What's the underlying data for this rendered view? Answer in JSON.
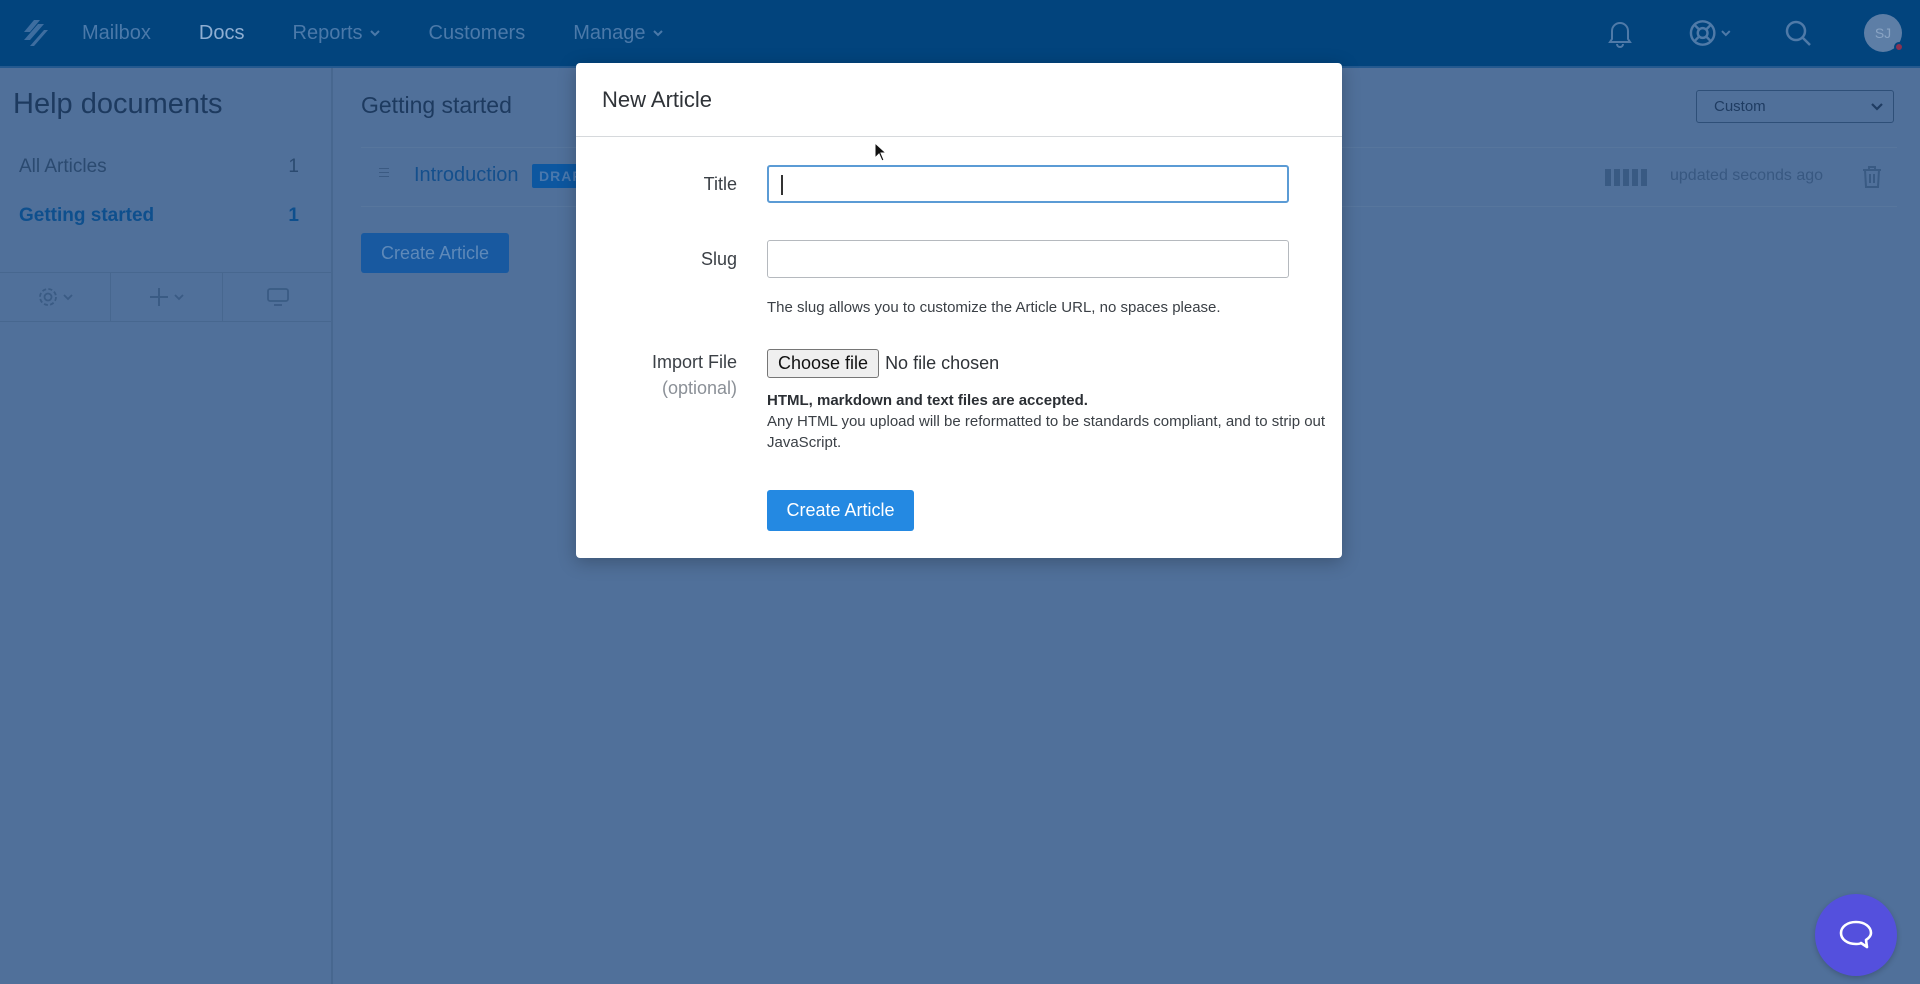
{
  "topnav": {
    "items": [
      {
        "label": "Mailbox",
        "dropdown": false,
        "active": false
      },
      {
        "label": "Docs",
        "dropdown": false,
        "active": true
      },
      {
        "label": "Reports",
        "dropdown": true,
        "active": false
      },
      {
        "label": "Customers",
        "dropdown": false,
        "active": false
      },
      {
        "label": "Manage",
        "dropdown": true,
        "active": false
      }
    ],
    "icons": [
      "bell-icon",
      "lifebuoy-icon",
      "search-icon"
    ],
    "avatar_initials": "SJ"
  },
  "sidebar": {
    "title": "Help documents",
    "items": [
      {
        "label": "All Articles",
        "count": "1"
      },
      {
        "label": "Getting started",
        "count": "1",
        "active": true
      }
    ],
    "tools": [
      "gear-icon",
      "plus-icon",
      "monitor-icon"
    ]
  },
  "main": {
    "title": "Getting started",
    "layout_select": "Custom",
    "article": {
      "title": "Introduction",
      "status": "DRAFT",
      "updated": "updated seconds ago"
    },
    "create_button": "Create Article"
  },
  "modal": {
    "title": "New Article",
    "fields": {
      "title_label": "Title",
      "title_value": "",
      "slug_label": "Slug",
      "slug_value": "",
      "slug_help": "The slug allows you to customize the Article URL, no spaces please.",
      "import_label": "Import File",
      "import_optional": "(optional)",
      "file_button": "Choose file",
      "file_status": "No file chosen",
      "import_help_bold": "HTML, markdown and text files are accepted.",
      "import_help": "Any HTML you upload will be reformatted to be standards compliant, and to strip out JavaScript."
    },
    "submit": "Create Article"
  },
  "colors": {
    "nav_bg": "#02447d",
    "overlay_bg": "#50709a",
    "primary_button": "#2489e2",
    "chat_button": "#5450dd"
  }
}
